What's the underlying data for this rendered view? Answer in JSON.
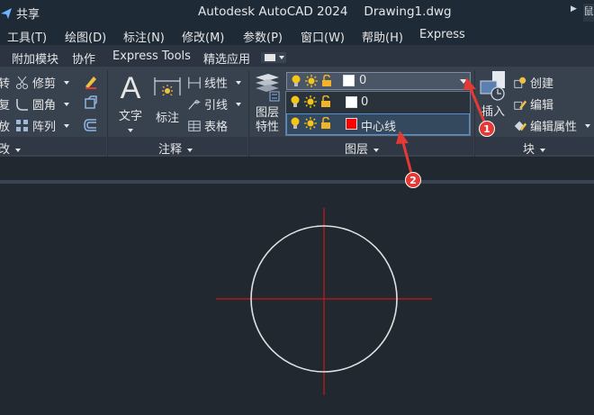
{
  "titlebar": {
    "share_label": "共享",
    "app_title": "Autodesk AutoCAD 2024",
    "document_title": "Drawing1.dwg",
    "right_text": "鼠"
  },
  "menubar": {
    "items": [
      "工具(T)",
      "绘图(D)",
      "标注(N)",
      "修改(M)",
      "参数(P)",
      "窗口(W)",
      "帮助(H)",
      "Express"
    ]
  },
  "ribbon_tabs": {
    "items": [
      "附加模块",
      "协作",
      "Express Tools",
      "精选应用"
    ]
  },
  "modify_panel": {
    "trim": "修剪",
    "fillet": "圆角",
    "array": "阵列",
    "label": "改",
    "left_glyphs": [
      "转",
      "复",
      "放"
    ]
  },
  "annotation_panel": {
    "text": "文字",
    "dimension": "标注",
    "linear": "线性",
    "leader": "引线",
    "table": "表格",
    "label": "注释"
  },
  "layers_panel": {
    "layer_properties": [
      "图层",
      "特性"
    ],
    "current_layer": "0",
    "dropdown": [
      {
        "name": "0",
        "color": "#ffffff"
      },
      {
        "name": "中心线",
        "color": "#ff0000"
      }
    ],
    "label": "图层"
  },
  "block_panel": {
    "insert": "插入",
    "create": "创建",
    "edit": "编辑",
    "edit_attributes": "编辑属性",
    "label": "块"
  },
  "callouts": [
    "1",
    "2"
  ],
  "colors": {
    "accent": "#e53935",
    "centerline": "#c41a1a",
    "circle": "#e0e0e0",
    "canvas": "#212830"
  }
}
